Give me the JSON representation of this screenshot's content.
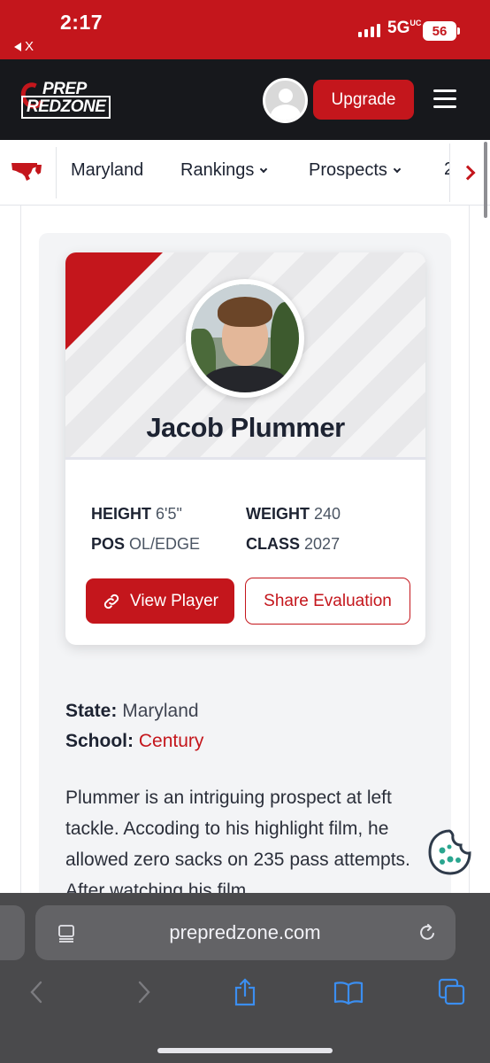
{
  "status_bar": {
    "time": "2:17",
    "back_label": "X",
    "network": "5G",
    "network_suffix": "UC",
    "battery": "56"
  },
  "header": {
    "logo_top": "PREP",
    "logo_bottom": "REDZONE",
    "upgrade_label": "Upgrade",
    "brand_color": "#c4161c"
  },
  "nav": {
    "items": [
      {
        "label": "Maryland",
        "dropdown": false
      },
      {
        "label": "Rankings",
        "dropdown": true
      },
      {
        "label": "Prospects",
        "dropdown": true
      }
    ],
    "cut_item": "2"
  },
  "player": {
    "name": "Jacob Plummer",
    "height_label": "HEIGHT",
    "height": "6'5\"",
    "weight_label": "WEIGHT",
    "weight": "240",
    "pos_label": "POS",
    "pos": "OL/EDGE",
    "class_label": "CLASS",
    "class": "2027",
    "view_button": "View Player",
    "share_button": "Share Evaluation"
  },
  "info": {
    "state_label": "State:",
    "state": "Maryland",
    "school_label": "School:",
    "school": "Century"
  },
  "bio": "Plummer is an intriguing prospect at left tackle. Accoding to his highlight film, he allowed zero sacks on 235 pass attempts. After watching his film",
  "browser": {
    "url": "prepredzone.com"
  }
}
